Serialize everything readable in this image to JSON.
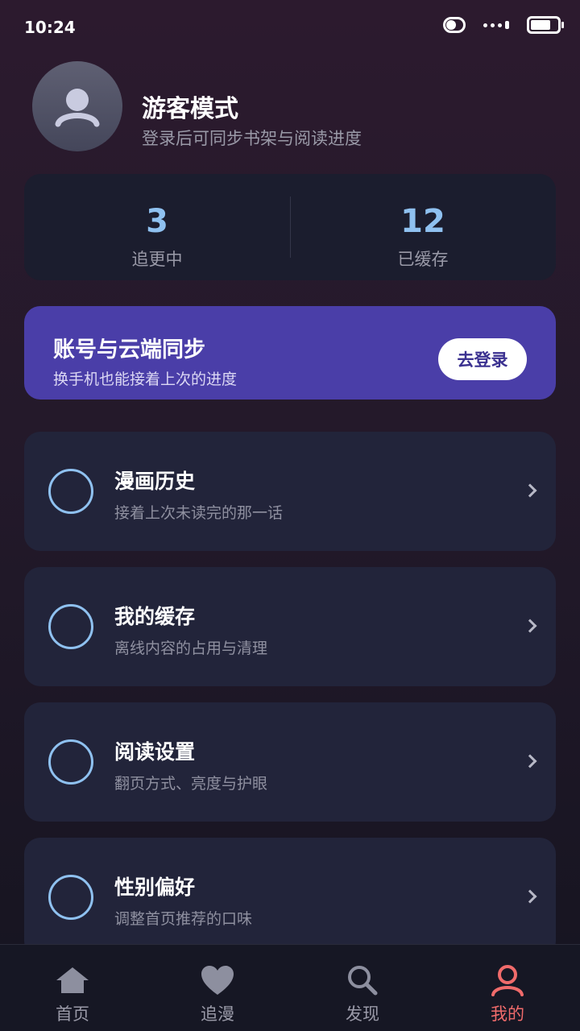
{
  "status_bar": {
    "time": "10:24"
  },
  "profile": {
    "name": "游客模式",
    "subtitle": "登录后可同步书架与阅读进度"
  },
  "stats": [
    {
      "value": "3",
      "label": "追更中"
    },
    {
      "value": "12",
      "label": "已缓存"
    }
  ],
  "sync_card": {
    "title": "账号与云端同步",
    "subtitle": "换手机也能接着上次的进度",
    "button_label": "去登录"
  },
  "menu": [
    {
      "title": "漫画历史",
      "desc": "接着上次未读完的那一话"
    },
    {
      "title": "我的缓存",
      "desc": "离线内容的占用与清理"
    },
    {
      "title": "阅读设置",
      "desc": "翻页方式、亮度与护眼"
    },
    {
      "title": "性别偏好",
      "desc": "调整首页推荐的口味"
    }
  ],
  "tabs": [
    {
      "label": "首页",
      "icon": "home-icon",
      "active": false
    },
    {
      "label": "追漫",
      "icon": "heart-icon",
      "active": false
    },
    {
      "label": "发现",
      "icon": "search-icon",
      "active": false
    },
    {
      "label": "我的",
      "icon": "user-icon",
      "active": true
    }
  ],
  "colors": {
    "accent": "#8fc1f0",
    "sync_card": "#4a3ea8",
    "active_tab": "#f06b6b"
  }
}
